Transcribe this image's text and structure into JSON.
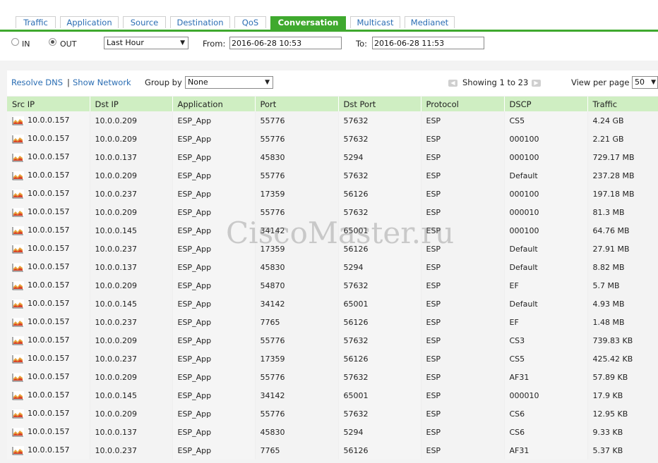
{
  "tabs": [
    {
      "label": "Traffic",
      "active": false
    },
    {
      "label": "Application",
      "active": false
    },
    {
      "label": "Source",
      "active": false
    },
    {
      "label": "Destination",
      "active": false
    },
    {
      "label": "QoS",
      "active": false
    },
    {
      "label": "Conversation",
      "active": true
    },
    {
      "label": "Multicast",
      "active": false
    },
    {
      "label": "Medianet",
      "active": false
    }
  ],
  "filters": {
    "in_label": "IN",
    "out_label": "OUT",
    "selected_direction": "OUT",
    "period": "Last Hour",
    "from_label": "From:",
    "from_value": "2016-06-28 10:53",
    "to_label": "To:",
    "to_value": "2016-06-28 11:53"
  },
  "toolbar": {
    "resolve_dns": "Resolve DNS",
    "separator": "|",
    "show_network": "Show Network",
    "group_by_label": "Group by",
    "group_by_value": "None",
    "showing": "Showing 1 to 23",
    "view_per_page_label": "View per page",
    "view_per_page_value": "50"
  },
  "table": {
    "columns": [
      "Src IP",
      "Dst IP",
      "Application",
      "Port",
      "Dst Port",
      "Protocol",
      "DSCP",
      "Traffic"
    ],
    "rows": [
      [
        "10.0.0.157",
        "10.0.0.209",
        "ESP_App",
        "55776",
        "57632",
        "ESP",
        "CS5",
        "4.24 GB"
      ],
      [
        "10.0.0.157",
        "10.0.0.209",
        "ESP_App",
        "55776",
        "57632",
        "ESP",
        "000100",
        "2.21 GB"
      ],
      [
        "10.0.0.157",
        "10.0.0.137",
        "ESP_App",
        "45830",
        "5294",
        "ESP",
        "000100",
        "729.17 MB"
      ],
      [
        "10.0.0.157",
        "10.0.0.209",
        "ESP_App",
        "55776",
        "57632",
        "ESP",
        "Default",
        "237.28 MB"
      ],
      [
        "10.0.0.157",
        "10.0.0.237",
        "ESP_App",
        "17359",
        "56126",
        "ESP",
        "000100",
        "197.18 MB"
      ],
      [
        "10.0.0.157",
        "10.0.0.209",
        "ESP_App",
        "55776",
        "57632",
        "ESP",
        "000010",
        "81.3 MB"
      ],
      [
        "10.0.0.157",
        "10.0.0.145",
        "ESP_App",
        "34142",
        "65001",
        "ESP",
        "000100",
        "64.76 MB"
      ],
      [
        "10.0.0.157",
        "10.0.0.237",
        "ESP_App",
        "17359",
        "56126",
        "ESP",
        "Default",
        "27.91 MB"
      ],
      [
        "10.0.0.157",
        "10.0.0.137",
        "ESP_App",
        "45830",
        "5294",
        "ESP",
        "Default",
        "8.82 MB"
      ],
      [
        "10.0.0.157",
        "10.0.0.209",
        "ESP_App",
        "54870",
        "57632",
        "ESP",
        "EF",
        "5.7 MB"
      ],
      [
        "10.0.0.157",
        "10.0.0.145",
        "ESP_App",
        "34142",
        "65001",
        "ESP",
        "Default",
        "4.93 MB"
      ],
      [
        "10.0.0.157",
        "10.0.0.237",
        "ESP_App",
        "7765",
        "56126",
        "ESP",
        "EF",
        "1.48 MB"
      ],
      [
        "10.0.0.157",
        "10.0.0.209",
        "ESP_App",
        "55776",
        "57632",
        "ESP",
        "CS3",
        "739.83 KB"
      ],
      [
        "10.0.0.157",
        "10.0.0.237",
        "ESP_App",
        "17359",
        "56126",
        "ESP",
        "CS5",
        "425.42 KB"
      ],
      [
        "10.0.0.157",
        "10.0.0.209",
        "ESP_App",
        "55776",
        "57632",
        "ESP",
        "AF31",
        "57.89 KB"
      ],
      [
        "10.0.0.157",
        "10.0.0.145",
        "ESP_App",
        "34142",
        "65001",
        "ESP",
        "000010",
        "17.9 KB"
      ],
      [
        "10.0.0.157",
        "10.0.0.209",
        "ESP_App",
        "55776",
        "57632",
        "ESP",
        "CS6",
        "12.95 KB"
      ],
      [
        "10.0.0.157",
        "10.0.0.137",
        "ESP_App",
        "45830",
        "5294",
        "ESP",
        "CS6",
        "9.33 KB"
      ],
      [
        "10.0.0.157",
        "10.0.0.237",
        "ESP_App",
        "7765",
        "56126",
        "ESP",
        "AF31",
        "5.37 KB"
      ]
    ]
  },
  "watermark": "CiscoMaster.ru",
  "colors": {
    "accent": "#3fa92e",
    "link": "#2a6db3",
    "header_bg": "#cfeec2"
  },
  "icons": {
    "row_icon": "area-chart-icon",
    "prev": "prev-page-icon",
    "next": "next-page-icon"
  }
}
